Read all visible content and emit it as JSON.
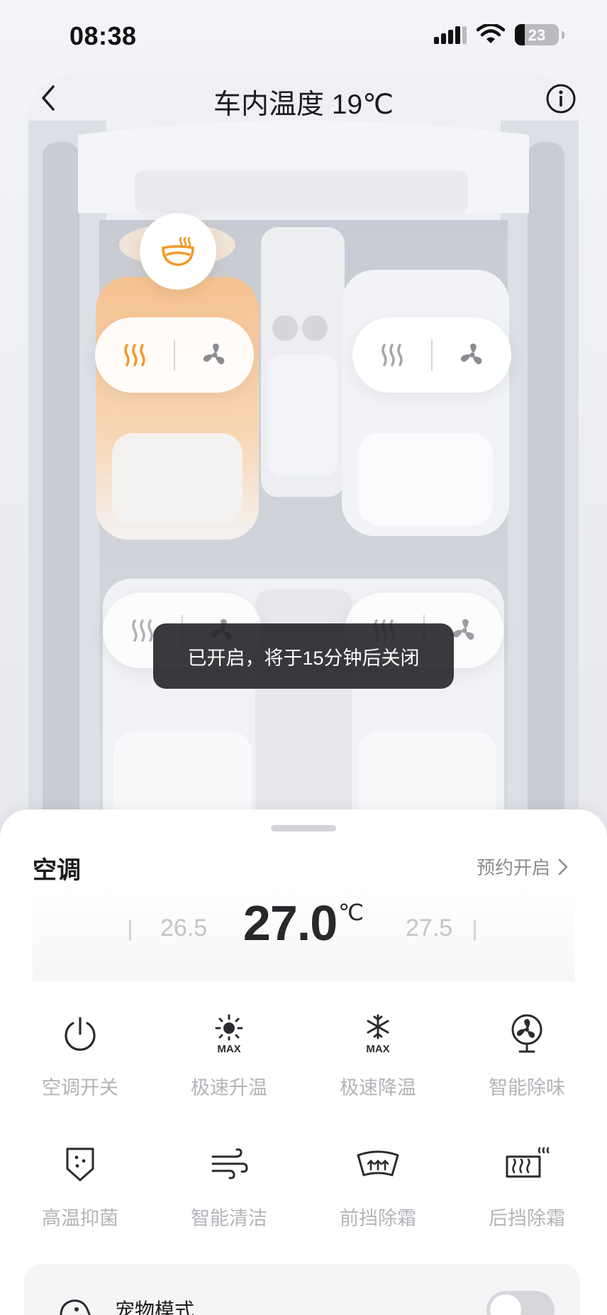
{
  "status_bar": {
    "time": "08:38",
    "battery_percent": "23"
  },
  "header": {
    "title": "车内温度 19℃"
  },
  "toast": {
    "text": "已开启，将于15分钟后关闭"
  },
  "seats": [
    {
      "position": "front-left",
      "heating_on": true,
      "ventilation_on": false
    },
    {
      "position": "front-right",
      "heating_on": false,
      "ventilation_on": false
    },
    {
      "position": "rear-left",
      "heating_on": false,
      "ventilation_on": false
    },
    {
      "position": "rear-right",
      "heating_on": false,
      "ventilation_on": false
    }
  ],
  "steering_wheel_heating_on": true,
  "climate": {
    "title": "空调",
    "schedule_label": "预约开启",
    "temperature": "27.0",
    "unit": "℃",
    "prev_temperature": "26.5",
    "next_temperature": "27.5"
  },
  "controls": [
    {
      "label": "空调开关",
      "icon": "power-icon"
    },
    {
      "label": "极速升温",
      "icon": "sun-max-icon"
    },
    {
      "label": "极速降温",
      "icon": "snowflake-max-icon"
    },
    {
      "label": "智能除味",
      "icon": "fan-icon"
    },
    {
      "label": "高温抑菌",
      "icon": "shield-icon"
    },
    {
      "label": "智能清洁",
      "icon": "wind-icon"
    },
    {
      "label": "前挡除霜",
      "icon": "front-defrost-icon"
    },
    {
      "label": "后挡除霜",
      "icon": "rear-defrost-icon"
    }
  ],
  "pet_mode": {
    "label": "宠物模式",
    "enabled": false
  },
  "colors": {
    "accent": "#F39A26",
    "toast_bg": "#1E1F22",
    "label_gray": "#B3B4B9"
  }
}
